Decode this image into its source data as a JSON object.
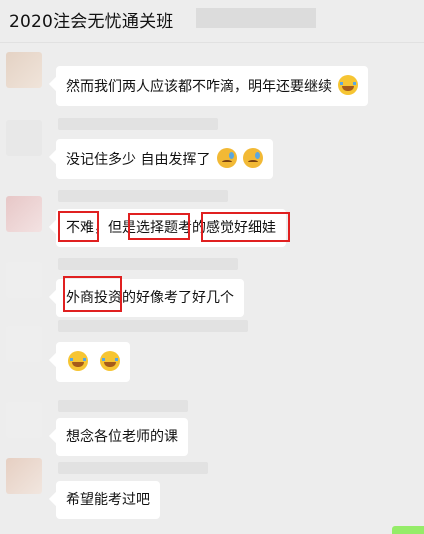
{
  "header": {
    "title": "2020注会无忧通关班"
  },
  "messages": [
    {
      "text": "然而我们两人应该都不咋滴，明年还要继续",
      "emojis": [
        "cry"
      ]
    },
    {
      "text": "没记住多少  自由发挥了",
      "emojis": [
        "sad",
        "sad"
      ]
    },
    {
      "text": "不难，但是选择题考的感觉好细娃",
      "emojis": []
    },
    {
      "text": "外商投资的好像考了好几个",
      "emojis": []
    },
    {
      "text": "",
      "emojis": [
        "cry",
        "cry"
      ]
    },
    {
      "text": "想念各位老师的课",
      "emojis": []
    },
    {
      "text": "希望能考过吧",
      "emojis": []
    }
  ],
  "colors": {
    "highlight": "#e02020",
    "bubble": "#ffffff",
    "background": "#ededed",
    "self_bubble": "#95ec69"
  }
}
